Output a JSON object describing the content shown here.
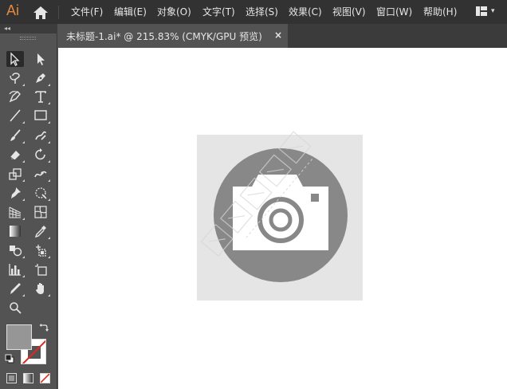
{
  "app": {
    "logo_text": "Ai",
    "brand_color": "#e08a3e"
  },
  "menubar": {
    "items": [
      {
        "label": "文件(F)"
      },
      {
        "label": "编辑(E)"
      },
      {
        "label": "对象(O)"
      },
      {
        "label": "文字(T)"
      },
      {
        "label": "选择(S)"
      },
      {
        "label": "效果(C)"
      },
      {
        "label": "视图(V)"
      },
      {
        "label": "窗口(W)"
      },
      {
        "label": "帮助(H)"
      }
    ],
    "home_icon": "home-icon",
    "workspace_icon": "layout-grid-icon"
  },
  "toolbar": {
    "collapse_glyph": "◂◂",
    "tools": [
      {
        "name": "selection-tool-icon",
        "selected": true
      },
      {
        "name": "direct-selection-tool-icon"
      },
      {
        "name": "magic-wand-tool-icon"
      },
      {
        "name": "pen-tool-icon"
      },
      {
        "name": "curvature-tool-icon"
      },
      {
        "name": "type-tool-icon"
      },
      {
        "name": "line-segment-tool-icon"
      },
      {
        "name": "rectangle-tool-icon"
      },
      {
        "name": "paintbrush-tool-icon"
      },
      {
        "name": "shaper-tool-icon"
      },
      {
        "name": "eraser-tool-icon"
      },
      {
        "name": "rotate-tool-icon"
      },
      {
        "name": "scale-tool-icon"
      },
      {
        "name": "width-tool-icon"
      },
      {
        "name": "puppet-warp-tool-icon"
      },
      {
        "name": "free-transform-tool-icon"
      },
      {
        "name": "perspective-grid-tool-icon"
      },
      {
        "name": "mesh-tool-icon"
      },
      {
        "name": "gradient-tool-icon"
      },
      {
        "name": "eyedropper-tool-icon"
      },
      {
        "name": "shape-builder-tool-icon"
      },
      {
        "name": "live-paint-selection-tool-icon"
      },
      {
        "name": "column-graph-tool-icon"
      },
      {
        "name": "artboard-tool-icon"
      },
      {
        "name": "slice-tool-icon"
      },
      {
        "name": "hand-tool-icon"
      },
      {
        "name": "zoom-tool-icon"
      }
    ],
    "fill_color": "#969696",
    "stroke_color": "none"
  },
  "document": {
    "tab_label": "未标题-1.ai* @ 215.83% (CMYK/GPU 预览)",
    "close_glyph": "×"
  },
  "artwork": {
    "background_color": "#e5e5e5",
    "circle_color": "#888888",
    "icon": "camera-icon"
  }
}
